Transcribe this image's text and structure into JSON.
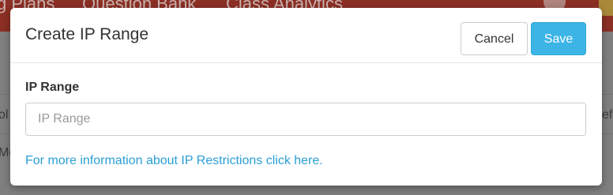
{
  "background": {
    "nav_items": [
      "g Plans",
      "Question Bank",
      "Class Analytics"
    ],
    "left_edge_texts": [
      "ol",
      "Mo"
    ],
    "right_edge_text": "ef"
  },
  "modal": {
    "title": "Create IP Range",
    "cancel_label": "Cancel",
    "save_label": "Save",
    "field_label": "IP Range",
    "field_value": "",
    "field_placeholder": "IP Range",
    "info_link_text": "For more information about IP Restrictions click here."
  },
  "colors": {
    "primary": "#3cb4e5",
    "link": "#2a9fd6",
    "navbar_dimmed": "#8c2f25"
  }
}
